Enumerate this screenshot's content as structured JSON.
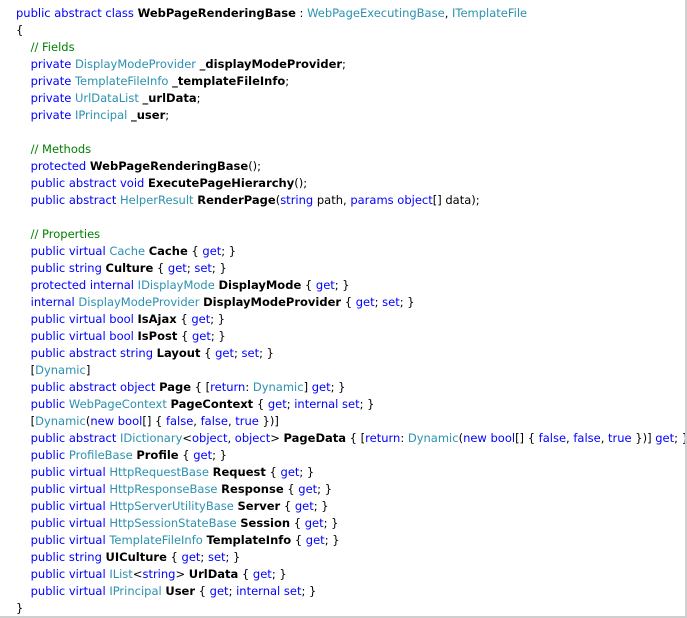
{
  "colors": {
    "keyword": "#0000ff",
    "type": "#2b91af",
    "comment": "#008000",
    "text": "#000000",
    "background": "#ffffff"
  },
  "code": {
    "lines": [
      [
        [
          "k",
          "public abstract class "
        ],
        [
          "b",
          "WebPageRenderingBase"
        ],
        [
          "p",
          " : "
        ],
        [
          "t",
          "WebPageExecutingBase"
        ],
        [
          "p",
          ", "
        ],
        [
          "t",
          "ITemplateFile"
        ]
      ],
      [
        [
          "p",
          "{"
        ]
      ],
      [
        [
          "c",
          "    // Fields"
        ]
      ],
      [
        [
          "k",
          "    private "
        ],
        [
          "t",
          "DisplayModeProvider"
        ],
        [
          "p",
          " "
        ],
        [
          "b",
          "_displayModeProvider"
        ],
        [
          "p",
          ";"
        ]
      ],
      [
        [
          "k",
          "    private "
        ],
        [
          "t",
          "TemplateFileInfo"
        ],
        [
          "p",
          " "
        ],
        [
          "b",
          "_templateFileInfo"
        ],
        [
          "p",
          ";"
        ]
      ],
      [
        [
          "k",
          "    private "
        ],
        [
          "t",
          "UrlDataList"
        ],
        [
          "p",
          " "
        ],
        [
          "b",
          "_urlData"
        ],
        [
          "p",
          ";"
        ]
      ],
      [
        [
          "k",
          "    private "
        ],
        [
          "t",
          "IPrincipal"
        ],
        [
          "p",
          " "
        ],
        [
          "b",
          "_user"
        ],
        [
          "p",
          ";"
        ]
      ],
      [
        [
          "p",
          ""
        ]
      ],
      [
        [
          "c",
          "    // Methods"
        ]
      ],
      [
        [
          "k",
          "    protected "
        ],
        [
          "b",
          "WebPageRenderingBase"
        ],
        [
          "p",
          "();"
        ]
      ],
      [
        [
          "k",
          "    public abstract void "
        ],
        [
          "b",
          "ExecutePageHierarchy"
        ],
        [
          "p",
          "();"
        ]
      ],
      [
        [
          "k",
          "    public abstract "
        ],
        [
          "t",
          "HelperResult"
        ],
        [
          "p",
          " "
        ],
        [
          "b",
          "RenderPage"
        ],
        [
          "p",
          "("
        ],
        [
          "k",
          "string"
        ],
        [
          "p",
          " path, "
        ],
        [
          "k",
          "params object"
        ],
        [
          "p",
          "[] data);"
        ]
      ],
      [
        [
          "p",
          ""
        ]
      ],
      [
        [
          "c",
          "    // Properties"
        ]
      ],
      [
        [
          "k",
          "    public virtual "
        ],
        [
          "t",
          "Cache"
        ],
        [
          "p",
          " "
        ],
        [
          "b",
          "Cache"
        ],
        [
          "p",
          " { "
        ],
        [
          "k",
          "get"
        ],
        [
          "p",
          "; }"
        ]
      ],
      [
        [
          "k",
          "    public string "
        ],
        [
          "b",
          "Culture"
        ],
        [
          "p",
          " { "
        ],
        [
          "k",
          "get"
        ],
        [
          "p",
          "; "
        ],
        [
          "k",
          "set"
        ],
        [
          "p",
          "; }"
        ]
      ],
      [
        [
          "k",
          "    protected internal "
        ],
        [
          "t",
          "IDisplayMode"
        ],
        [
          "p",
          " "
        ],
        [
          "b",
          "DisplayMode"
        ],
        [
          "p",
          " { "
        ],
        [
          "k",
          "get"
        ],
        [
          "p",
          "; }"
        ]
      ],
      [
        [
          "k",
          "    internal "
        ],
        [
          "t",
          "DisplayModeProvider"
        ],
        [
          "p",
          " "
        ],
        [
          "b",
          "DisplayModeProvider"
        ],
        [
          "p",
          " { "
        ],
        [
          "k",
          "get"
        ],
        [
          "p",
          "; "
        ],
        [
          "k",
          "set"
        ],
        [
          "p",
          "; }"
        ]
      ],
      [
        [
          "k",
          "    public virtual bool "
        ],
        [
          "b",
          "IsAjax"
        ],
        [
          "p",
          " { "
        ],
        [
          "k",
          "get"
        ],
        [
          "p",
          "; }"
        ]
      ],
      [
        [
          "k",
          "    public virtual bool "
        ],
        [
          "b",
          "IsPost"
        ],
        [
          "p",
          " { "
        ],
        [
          "k",
          "get"
        ],
        [
          "p",
          "; }"
        ]
      ],
      [
        [
          "k",
          "    public abstract string "
        ],
        [
          "b",
          "Layout"
        ],
        [
          "p",
          " { "
        ],
        [
          "k",
          "get"
        ],
        [
          "p",
          "; "
        ],
        [
          "k",
          "set"
        ],
        [
          "p",
          "; }"
        ]
      ],
      [
        [
          "p",
          "    ["
        ],
        [
          "t",
          "Dynamic"
        ],
        [
          "p",
          "]"
        ]
      ],
      [
        [
          "k",
          "    public abstract object "
        ],
        [
          "b",
          "Page"
        ],
        [
          "p",
          " { ["
        ],
        [
          "k",
          "return"
        ],
        [
          "p",
          ": "
        ],
        [
          "t",
          "Dynamic"
        ],
        [
          "p",
          "] "
        ],
        [
          "k",
          "get"
        ],
        [
          "p",
          "; }"
        ]
      ],
      [
        [
          "k",
          "    public "
        ],
        [
          "t",
          "WebPageContext"
        ],
        [
          "p",
          " "
        ],
        [
          "b",
          "PageContext"
        ],
        [
          "p",
          " { "
        ],
        [
          "k",
          "get"
        ],
        [
          "p",
          "; "
        ],
        [
          "k",
          "internal set"
        ],
        [
          "p",
          "; }"
        ]
      ],
      [
        [
          "p",
          "    ["
        ],
        [
          "t",
          "Dynamic"
        ],
        [
          "p",
          "("
        ],
        [
          "k",
          "new bool"
        ],
        [
          "p",
          "[] { "
        ],
        [
          "k",
          "false"
        ],
        [
          "p",
          ", "
        ],
        [
          "k",
          "false"
        ],
        [
          "p",
          ", "
        ],
        [
          "k",
          "true"
        ],
        [
          "p",
          " })]"
        ]
      ],
      [
        [
          "k",
          "    public abstract "
        ],
        [
          "t",
          "IDictionary"
        ],
        [
          "p",
          "<"
        ],
        [
          "k",
          "object"
        ],
        [
          "p",
          ", "
        ],
        [
          "k",
          "object"
        ],
        [
          "p",
          "> "
        ],
        [
          "b",
          "PageData"
        ],
        [
          "p",
          " { ["
        ],
        [
          "k",
          "return"
        ],
        [
          "p",
          ": "
        ],
        [
          "t",
          "Dynamic"
        ],
        [
          "p",
          "("
        ],
        [
          "k",
          "new bool"
        ],
        [
          "p",
          "[] { "
        ],
        [
          "k",
          "false"
        ],
        [
          "p",
          ", "
        ],
        [
          "k",
          "false"
        ],
        [
          "p",
          ", "
        ],
        [
          "k",
          "true"
        ],
        [
          "p",
          " })] "
        ],
        [
          "k",
          "get"
        ],
        [
          "p",
          "; }"
        ]
      ],
      [
        [
          "k",
          "    public "
        ],
        [
          "t",
          "ProfileBase"
        ],
        [
          "p",
          " "
        ],
        [
          "b",
          "Profile"
        ],
        [
          "p",
          " { "
        ],
        [
          "k",
          "get"
        ],
        [
          "p",
          "; }"
        ]
      ],
      [
        [
          "k",
          "    public virtual "
        ],
        [
          "t",
          "HttpRequestBase"
        ],
        [
          "p",
          " "
        ],
        [
          "b",
          "Request"
        ],
        [
          "p",
          " { "
        ],
        [
          "k",
          "get"
        ],
        [
          "p",
          "; }"
        ]
      ],
      [
        [
          "k",
          "    public virtual "
        ],
        [
          "t",
          "HttpResponseBase"
        ],
        [
          "p",
          " "
        ],
        [
          "b",
          "Response"
        ],
        [
          "p",
          " { "
        ],
        [
          "k",
          "get"
        ],
        [
          "p",
          "; }"
        ]
      ],
      [
        [
          "k",
          "    public virtual "
        ],
        [
          "t",
          "HttpServerUtilityBase"
        ],
        [
          "p",
          " "
        ],
        [
          "b",
          "Server"
        ],
        [
          "p",
          " { "
        ],
        [
          "k",
          "get"
        ],
        [
          "p",
          "; }"
        ]
      ],
      [
        [
          "k",
          "    public virtual "
        ],
        [
          "t",
          "HttpSessionStateBase"
        ],
        [
          "p",
          " "
        ],
        [
          "b",
          "Session"
        ],
        [
          "p",
          " { "
        ],
        [
          "k",
          "get"
        ],
        [
          "p",
          "; }"
        ]
      ],
      [
        [
          "k",
          "    public virtual "
        ],
        [
          "t",
          "TemplateFileInfo"
        ],
        [
          "p",
          " "
        ],
        [
          "b",
          "TemplateInfo"
        ],
        [
          "p",
          " { "
        ],
        [
          "k",
          "get"
        ],
        [
          "p",
          "; }"
        ]
      ],
      [
        [
          "k",
          "    public string "
        ],
        [
          "b",
          "UICulture"
        ],
        [
          "p",
          " { "
        ],
        [
          "k",
          "get"
        ],
        [
          "p",
          "; "
        ],
        [
          "k",
          "set"
        ],
        [
          "p",
          "; }"
        ]
      ],
      [
        [
          "k",
          "    public virtual "
        ],
        [
          "t",
          "IList"
        ],
        [
          "p",
          "<"
        ],
        [
          "k",
          "string"
        ],
        [
          "p",
          "> "
        ],
        [
          "b",
          "UrlData"
        ],
        [
          "p",
          " { "
        ],
        [
          "k",
          "get"
        ],
        [
          "p",
          "; }"
        ]
      ],
      [
        [
          "k",
          "    public virtual "
        ],
        [
          "t",
          "IPrincipal"
        ],
        [
          "p",
          " "
        ],
        [
          "b",
          "User"
        ],
        [
          "p",
          " { "
        ],
        [
          "k",
          "get"
        ],
        [
          "p",
          "; "
        ],
        [
          "k",
          "internal set"
        ],
        [
          "p",
          "; }"
        ]
      ],
      [
        [
          "p",
          "}"
        ]
      ]
    ]
  }
}
